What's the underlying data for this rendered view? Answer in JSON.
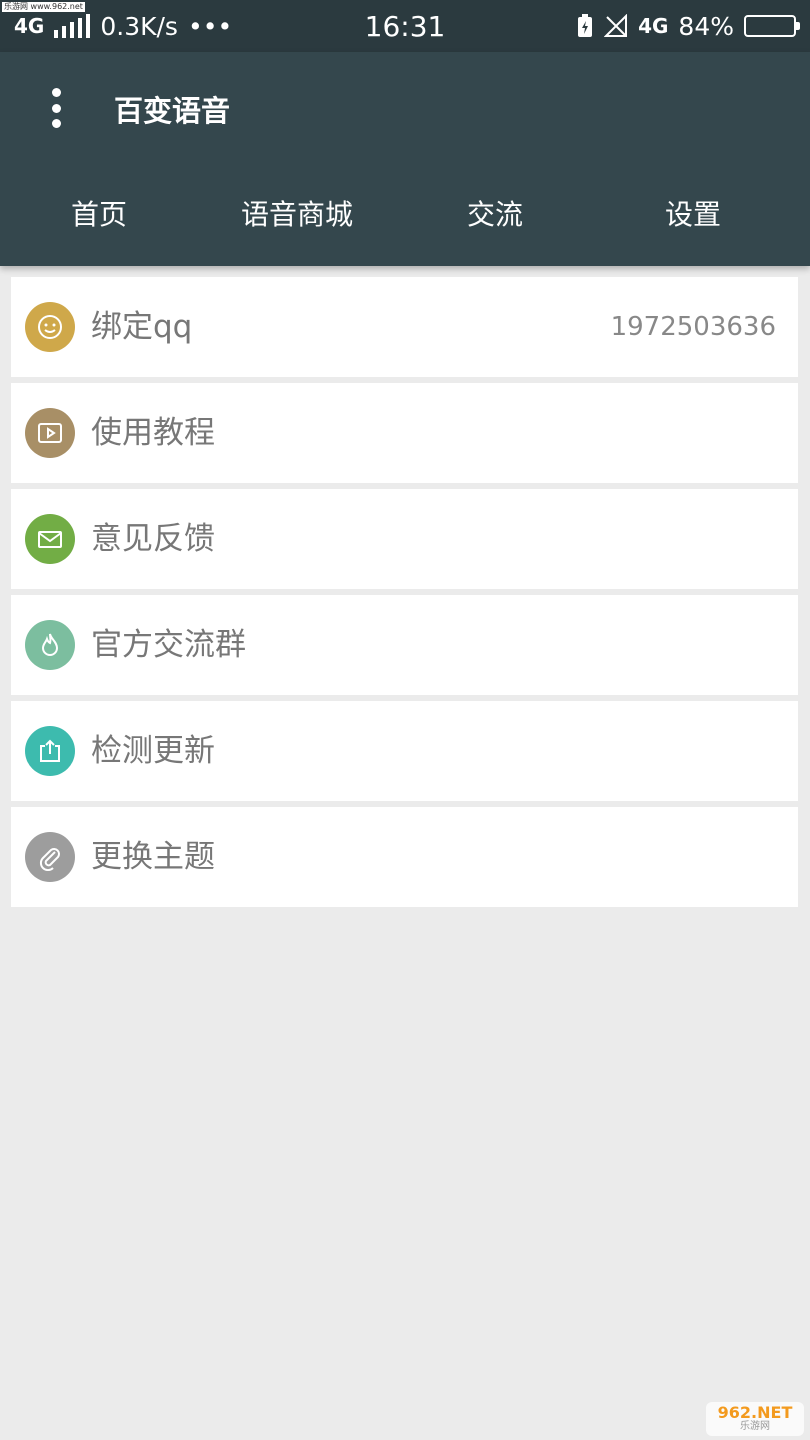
{
  "status_bar": {
    "network": "4G",
    "speed": "0.3K/s",
    "more": "•••",
    "time": "16:31",
    "network2": "4G",
    "battery": "84%",
    "battery_level": 0.84
  },
  "watermark": {
    "top_left": "乐游网 www.962.net",
    "logo_big": "962.NET",
    "logo_small": "乐游网"
  },
  "app_bar": {
    "title": "百变语音",
    "tabs": [
      {
        "label": "首页"
      },
      {
        "label": "语音商城"
      },
      {
        "label": "交流"
      },
      {
        "label": "设置"
      }
    ]
  },
  "settings": {
    "items": [
      {
        "label": "绑定qq",
        "value": "1972503636",
        "icon": "smiley-icon",
        "color": "#cfa84a"
      },
      {
        "label": "使用教程",
        "icon": "video-icon",
        "color": "#a88f66"
      },
      {
        "label": "意见反馈",
        "icon": "mail-icon",
        "color": "#72ad45"
      },
      {
        "label": "官方交流群",
        "icon": "flame-icon",
        "color": "#7cbe9f"
      },
      {
        "label": "检测更新",
        "icon": "upload-icon",
        "color": "#3dbbae"
      },
      {
        "label": "更换主题",
        "icon": "paperclip-icon",
        "color": "#9d9d9d"
      }
    ]
  },
  "colors": {
    "status_bar": "#2b3a3f",
    "app_bar": "#34474d",
    "background": "#ebebeb"
  }
}
